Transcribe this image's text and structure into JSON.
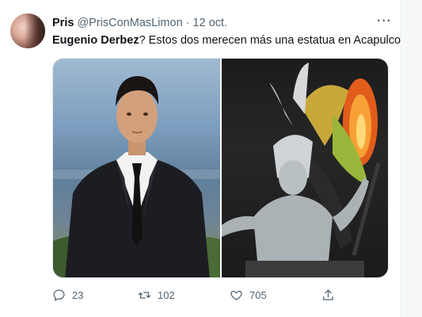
{
  "tweet": {
    "author_name": "Pris",
    "author_handle": "@PrisConMasLimon",
    "separator": "·",
    "date": "12 oct.",
    "text_bold": "Eugenio Derbez",
    "text_rest": "? Estos dos merecen más una estatua en Acapulco"
  },
  "metrics": {
    "replies": "23",
    "retweets": "102",
    "likes": "705"
  },
  "colors": {
    "text_primary": "#0f1419",
    "text_secondary": "#536471",
    "border": "#e1e8ed"
  },
  "icons": {
    "more": "more-icon",
    "reply": "reply-icon",
    "retweet": "retweet-icon",
    "like": "like-icon",
    "share": "share-icon"
  }
}
